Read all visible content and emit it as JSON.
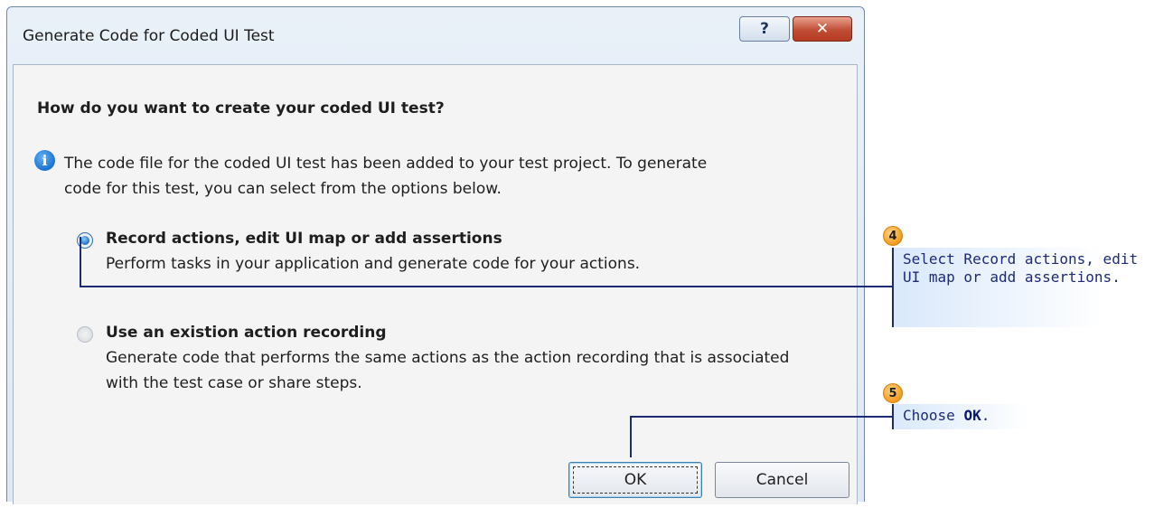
{
  "dialog": {
    "title": "Generate Code for Coded UI Test",
    "help_label": "?",
    "close_label": "✕",
    "heading": "How do you want to create your coded UI test?",
    "info_text": "The code file for the coded UI test has been added to your test project. To generate code for this test, you can select from the options below.",
    "options": [
      {
        "title": "Record actions, edit UI map or add assertions",
        "description": "Perform tasks in your application and generate code for your actions.",
        "selected": true
      },
      {
        "title": "Use an existion action recording",
        "description": "Generate code that performs the same actions as the action recording that is associated with the test case or share steps.",
        "selected": false
      }
    ],
    "ok_label": "OK",
    "cancel_label": "Cancel"
  },
  "callouts": [
    {
      "number": "4",
      "text": "Select Record actions, edit UI map or add assertions."
    },
    {
      "number": "5",
      "text_prefix": "Choose ",
      "text_bold": "OK",
      "text_suffix": "."
    }
  ],
  "colors": {
    "accent": "#1e2a78",
    "callout_badge": "#f29b1c",
    "close_button": "#c04d34"
  }
}
